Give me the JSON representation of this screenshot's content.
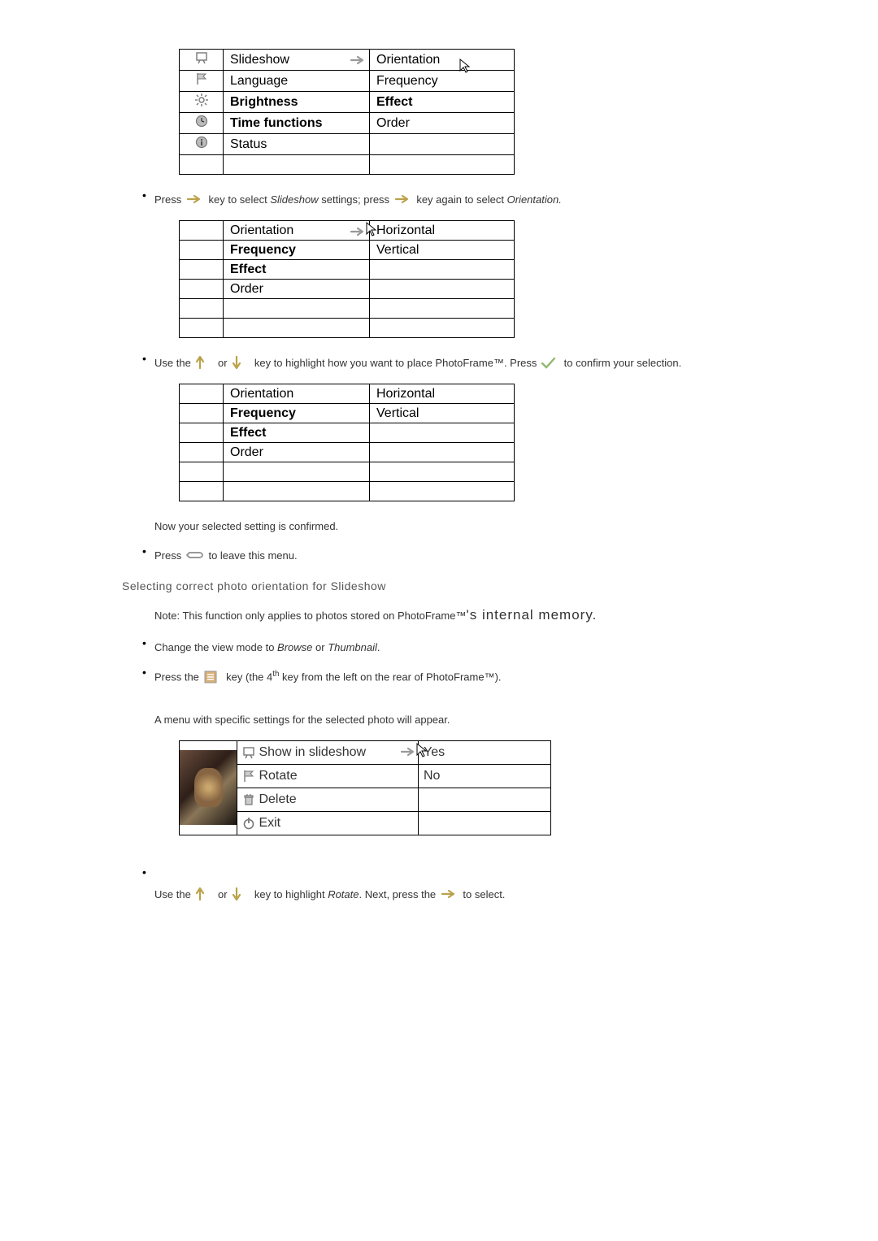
{
  "menu1": {
    "rows": [
      {
        "icon": "slideshow-icon",
        "label": "Slideshow",
        "value": "Orientation",
        "arrow": true,
        "cursor": "value"
      },
      {
        "icon": "flag-icon",
        "label": "Language",
        "value": "Frequency"
      },
      {
        "icon": "brightness-icon",
        "label": "Brightness",
        "value": "Effect",
        "bold": true
      },
      {
        "icon": "clock-icon",
        "label": "Time functions",
        "value": "Order",
        "bold": true
      },
      {
        "icon": "info-icon",
        "label": "Status",
        "value": ""
      },
      {
        "icon": "",
        "label": "",
        "value": ""
      }
    ]
  },
  "para1": {
    "p1": "Press",
    "p2": "key to select ",
    "slideshow": "Slideshow",
    "p3": " settings; press",
    "p4": "key again to select ",
    "orientation": "Orientation."
  },
  "menu2": {
    "rows": [
      {
        "label": "Orientation",
        "value": "Horizontal",
        "arrow": true,
        "cursor": "value"
      },
      {
        "label": "Frequency",
        "value": "Vertical",
        "bold": true
      },
      {
        "label": "Effect",
        "value": "",
        "bold": true
      },
      {
        "label": "Order",
        "value": ""
      },
      {
        "label": "",
        "value": ""
      },
      {
        "label": "",
        "value": ""
      }
    ]
  },
  "para2": {
    "t1": "Use the ",
    "t2": " or ",
    "t3": " key to highlight how you want to place PhotoFrame™. Press",
    "t4": " to confirm your selection."
  },
  "menu3": {
    "rows": [
      {
        "label": "Orientation",
        "value": "Horizontal"
      },
      {
        "label": "Frequency",
        "value": "Vertical",
        "bold": true
      },
      {
        "label": "Effect",
        "value": "",
        "bold": true
      },
      {
        "label": "Order",
        "value": ""
      },
      {
        "label": "",
        "value": ""
      },
      {
        "label": "",
        "value": ""
      }
    ]
  },
  "confirm_text": "Now your selected setting is confirmed.",
  "para3": {
    "t1": "Press ",
    "t2": " to leave this menu."
  },
  "heading": "Selecting correct photo orientation for Slideshow",
  "note": {
    "t1": "Note: This function only applies to photos stored on PhotoFrame™",
    "t2": "'s internal memory."
  },
  "bullet_browse": {
    "t1": "Change the view mode to ",
    "browse": "Browse",
    "or": " or ",
    "thumb": "Thumbnail",
    "dot": "."
  },
  "bullet_menukey": {
    "t1": "Press the ",
    "t2": " key (the 4",
    "th": "th",
    "t3": " key from the left on the rear of PhotoFrame™)."
  },
  "menu_appear": "A menu with specific settings for the selected photo will appear.",
  "menu4": {
    "rows": [
      {
        "icon": "slideshow-icon",
        "label": "Show in slideshow",
        "value": "Yes",
        "arrow": true,
        "cursor": "value"
      },
      {
        "icon": "flag-icon",
        "label": "Rotate",
        "value": "No"
      },
      {
        "icon": "trash-icon",
        "label": "Delete",
        "value": ""
      },
      {
        "icon": "power-icon",
        "label": "Exit",
        "value": ""
      }
    ]
  },
  "para4": {
    "t1": "Use the ",
    "t2": " or ",
    "t3": " key to highlight ",
    "rotate": "Rotate",
    "t4": ". Next, press the ",
    "t5": " to select."
  }
}
